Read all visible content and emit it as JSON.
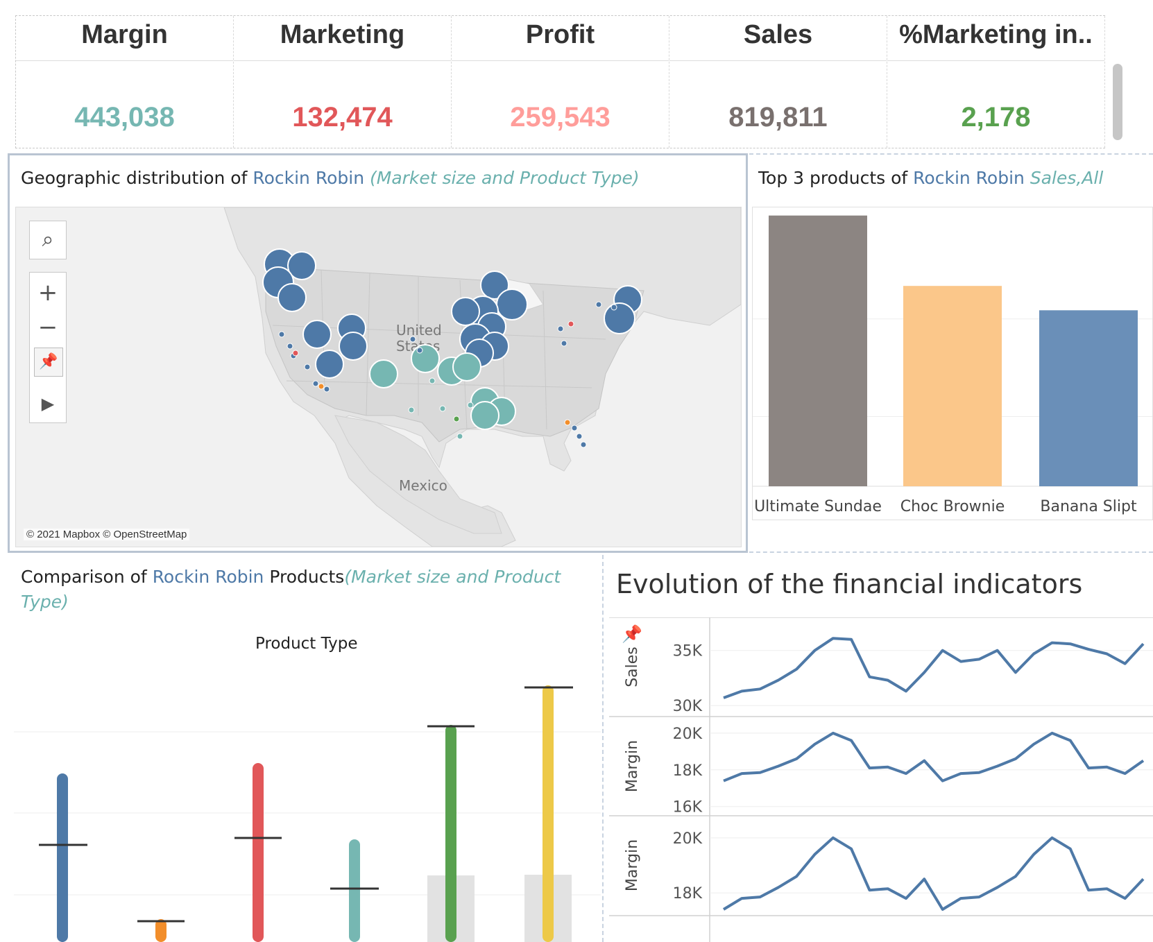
{
  "kpis": [
    {
      "label": "Margin",
      "value": "443,038",
      "color": "#76b7b2"
    },
    {
      "label": "Marketing",
      "value": "132,474",
      "color": "#e15759"
    },
    {
      "label": "Profit",
      "value": "259,543",
      "color": "#ff9d9a"
    },
    {
      "label": "Sales",
      "value": "819,811",
      "color": "#79706e"
    },
    {
      "label": "%Marketing in..",
      "value": "2,178",
      "color": "#59a14f"
    }
  ],
  "map": {
    "title_prefix": "Geographic distribution of ",
    "title_company": "Rockin Robin",
    "title_suffix": "(Market size and Product Type)",
    "labels": {
      "us_line1": "United",
      "us_line2": "States",
      "mexico": "Mexico"
    },
    "credit": "© 2021 Mapbox © OpenStreetMap",
    "tools": [
      "search-icon",
      "zoom-in-icon",
      "zoom-out-icon",
      "pin-clear-icon",
      "play-icon"
    ]
  },
  "top3": {
    "title_prefix": "Top 3 products of ",
    "title_company": "Rockin Robin",
    "title_suffix": "Sales,All"
  },
  "comparison": {
    "title_prefix": "Comparison of ",
    "title_company": "Rockin Robin",
    "title_middle": " Products",
    "title_suffix_line1": "(Market size and Product",
    "title_suffix_line2": "Type)",
    "header": "Product Type"
  },
  "evolution": {
    "title": "Evolution of the financial indicators"
  },
  "chart_data": [
    {
      "type": "bar",
      "title": "Top 3 products of Rockin Robin Sales,All",
      "categories": [
        "Ultimate Sundae",
        "Choc Brownie",
        "Banana Slipt"
      ],
      "values": [
        100,
        74,
        65
      ],
      "colors": [
        "#8c8582",
        "#fbc78a",
        "#6a8fb8"
      ],
      "ylim": [
        0,
        103
      ],
      "grid": true
    },
    {
      "type": "line",
      "title": "Evolution of the financial indicators",
      "x": [
        1,
        2,
        3,
        4,
        5,
        6,
        7,
        8,
        9,
        10,
        11,
        12,
        13,
        14,
        15,
        16,
        17,
        18,
        19,
        20,
        21,
        22,
        23,
        24
      ],
      "panels": [
        {
          "ylabel": "Sales",
          "ticks": [
            "35K",
            "30K"
          ],
          "tick_values": [
            35000,
            30000
          ],
          "ylim": [
            29500,
            37500
          ],
          "values": [
            30700,
            31300,
            31500,
            32300,
            33300,
            35000,
            36100,
            36000,
            32600,
            32300,
            31300,
            33000,
            35000,
            34000,
            34200,
            35000,
            33000,
            34700,
            35700,
            35600,
            35100,
            34700,
            33800,
            35600
          ]
        },
        {
          "ylabel": "Margin",
          "ticks": [
            "20K",
            "18K",
            "16K"
          ],
          "tick_values": [
            20000,
            18000,
            16000
          ],
          "ylim": [
            15800,
            20600
          ],
          "values": [
            17400,
            17800,
            17850,
            18200,
            18600,
            19400,
            20000,
            19600,
            18100,
            18150,
            17800,
            18500,
            17400,
            17800,
            17850,
            18200,
            18600,
            19400,
            20000,
            19600,
            18100,
            18150,
            17800,
            18500
          ]
        },
        {
          "ylabel": "Margin",
          "ticks": [
            "20K",
            "18K"
          ],
          "tick_values": [
            20000,
            18000
          ],
          "ylim": [
            17400,
            20600
          ],
          "values": [
            17400,
            17800,
            17850,
            18200,
            18600,
            19400,
            20000,
            19600,
            18100,
            18150,
            17800,
            18500,
            17400,
            17800,
            17850,
            18200,
            18600,
            19400,
            20000,
            19600,
            18100,
            18150,
            17800,
            18500
          ]
        }
      ]
    }
  ]
}
